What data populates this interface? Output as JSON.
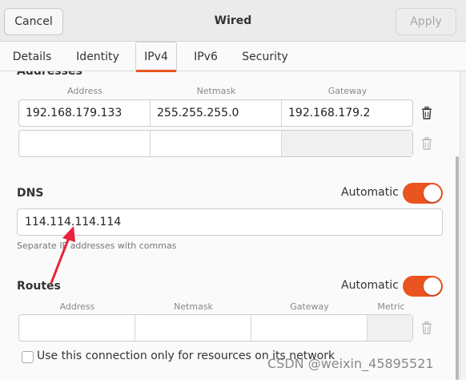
{
  "header": {
    "cancel_label": "Cancel",
    "title": "Wired",
    "apply_label": "Apply"
  },
  "tabs": [
    {
      "label": "Details"
    },
    {
      "label": "Identity"
    },
    {
      "label": "IPv4",
      "active": true
    },
    {
      "label": "IPv6"
    },
    {
      "label": "Security"
    }
  ],
  "addresses": {
    "title": "Addresses",
    "columns": [
      "Address",
      "Netmask",
      "Gateway"
    ],
    "rows": [
      [
        "192.168.179.133",
        "255.255.255.0",
        "192.168.179.2"
      ],
      [
        "",
        "",
        ""
      ]
    ]
  },
  "dns": {
    "title": "DNS",
    "automatic_label": "Automatic",
    "automatic": true,
    "value": "114.114.114.114",
    "hint": "Separate IP addresses with commas"
  },
  "routes": {
    "title": "Routes",
    "automatic_label": "Automatic",
    "automatic": true,
    "columns": [
      "Address",
      "Netmask",
      "Gateway",
      "Metric"
    ],
    "rows": [
      [
        "",
        "",
        "",
        ""
      ]
    ]
  },
  "only_resources_label": "Use this connection only for resources on its network",
  "watermark": "CSDN @weixin_45895521",
  "colors": {
    "accent": "#e95420",
    "annotation_arrow": "#e8203a"
  }
}
